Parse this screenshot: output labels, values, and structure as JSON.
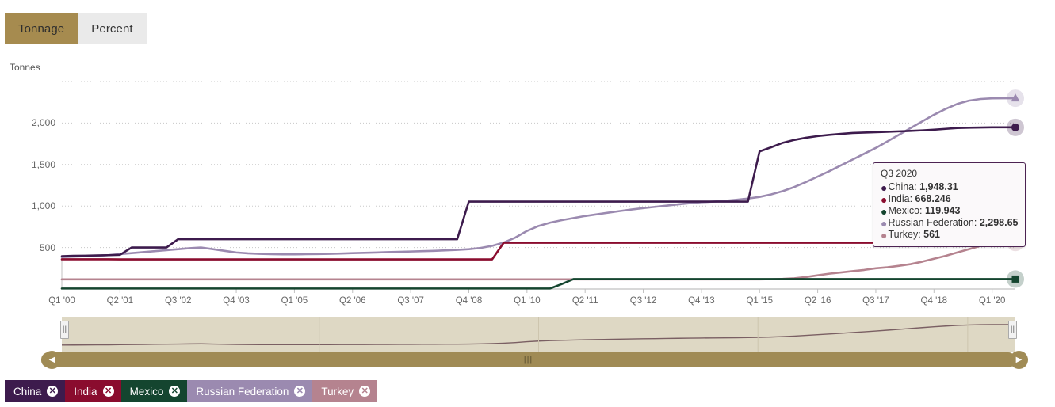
{
  "toggle": {
    "options": [
      {
        "label": "Tonnage",
        "active": true
      },
      {
        "label": "Percent",
        "active": false
      }
    ]
  },
  "axis_unit_label": "Tonnes",
  "tooltip": {
    "title": "Q3 2020",
    "rows": [
      {
        "name": "China",
        "value": "1,948.31",
        "color": "#3d1b4d"
      },
      {
        "name": "India",
        "value": "668.246",
        "color": "#8a0c2e"
      },
      {
        "name": "Mexico",
        "value": "119.943",
        "color": "#14452f"
      },
      {
        "name": "Russian Federation",
        "value": "2,298.65",
        "color": "#9b8ab0"
      },
      {
        "name": "Turkey",
        "value": "561",
        "color": "#b5838f"
      }
    ]
  },
  "navigator": {
    "left_arrow": "◀",
    "right_arrow": "▶",
    "grip": "|||",
    "left_handle": "||",
    "right_handle": "||"
  },
  "legend": {
    "items": [
      {
        "label": "China",
        "color": "#3d1b4d",
        "close": "✕"
      },
      {
        "label": "India",
        "color": "#8a0c2e",
        "close": "✕"
      },
      {
        "label": "Mexico",
        "color": "#14452f",
        "close": "✕"
      },
      {
        "label": "Russian Federation",
        "color": "#9b8ab0",
        "close": "✕"
      },
      {
        "label": "Turkey",
        "color": "#b5838f",
        "close": "✕"
      }
    ]
  },
  "chart_data": {
    "type": "line",
    "title": "",
    "xlabel": "",
    "ylabel": "Tonnes",
    "ylim": [
      0,
      2500
    ],
    "yticks": [
      500,
      1000,
      1500,
      2000
    ],
    "ytick_labels": [
      "500",
      "1,000",
      "1,500",
      "2,000"
    ],
    "grid": true,
    "legend_position": "bottom",
    "x_tick_labels": [
      "Q1 '00",
      "Q2 '01",
      "Q3 '02",
      "Q4 '03",
      "Q1 '05",
      "Q2 '06",
      "Q3 '07",
      "Q4 '08",
      "Q1 '10",
      "Q2 '11",
      "Q3 '12",
      "Q4 '13",
      "Q1 '15",
      "Q2 '16",
      "Q3 '17",
      "Q4 '18",
      "Q1 '20"
    ],
    "x_tick_indices": [
      0,
      5,
      10,
      15,
      20,
      25,
      30,
      35,
      40,
      45,
      50,
      55,
      60,
      65,
      70,
      75,
      80
    ],
    "x_index_range": [
      0,
      82
    ],
    "series": [
      {
        "name": "China",
        "color": "#3d1b4d",
        "marker": "circle",
        "values": [
          395,
          400,
          402,
          405,
          408,
          412,
          500,
          500,
          500,
          500,
          600,
          600,
          600,
          600,
          600,
          600,
          600,
          600,
          600,
          600,
          600,
          600,
          600,
          600,
          600,
          600,
          600,
          600,
          600,
          600,
          600,
          600,
          600,
          600,
          600,
          1054,
          1054,
          1054,
          1054,
          1054,
          1054,
          1054,
          1054,
          1054,
          1054,
          1054,
          1054,
          1054,
          1054,
          1054,
          1054,
          1054,
          1054,
          1054,
          1054,
          1054,
          1054,
          1054,
          1054,
          1054,
          1658,
          1708,
          1762,
          1797,
          1823,
          1843,
          1858,
          1870,
          1880,
          1885,
          1890,
          1895,
          1900,
          1905,
          1912,
          1920,
          1930,
          1940,
          1944,
          1946,
          1948,
          1948,
          1948
        ]
      },
      {
        "name": "India",
        "color": "#8a0c2e",
        "marker": "diamond",
        "values": [
          358,
          358,
          358,
          358,
          358,
          357,
          357,
          357,
          357,
          357,
          357,
          357,
          357,
          357,
          357,
          357,
          357,
          357,
          357,
          357,
          357,
          357,
          357,
          357,
          357,
          357,
          357,
          357,
          357,
          357,
          357,
          357,
          357,
          357,
          357,
          357,
          357,
          357,
          558,
          558,
          558,
          558,
          558,
          558,
          558,
          558,
          558,
          558,
          558,
          558,
          558,
          558,
          558,
          558,
          558,
          558,
          558,
          558,
          558,
          558,
          558,
          558,
          558,
          558,
          558,
          558,
          558,
          558,
          558,
          558,
          558,
          558,
          558,
          558,
          558,
          558,
          560,
          618,
          653,
          660,
          664,
          668,
          668
        ]
      },
      {
        "name": "Mexico",
        "color": "#14452f",
        "marker": "square",
        "values": [
          6,
          6,
          6,
          6,
          6,
          6,
          6,
          6,
          6,
          6,
          6,
          6,
          6,
          6,
          6,
          6,
          6,
          6,
          6,
          6,
          6,
          6,
          6,
          6,
          6,
          6,
          6,
          6,
          6,
          6,
          6,
          6,
          6,
          6,
          6,
          6,
          6,
          6,
          6,
          6,
          6,
          6,
          7,
          60,
          120,
          120,
          120,
          120,
          120,
          120,
          120,
          120,
          120,
          120,
          120,
          120,
          120,
          120,
          120,
          120,
          120,
          120,
          120,
          120,
          120,
          120,
          120,
          120,
          120,
          120,
          120,
          120,
          120,
          120,
          120,
          120,
          120,
          120,
          120,
          120,
          120,
          120,
          120
        ]
      },
      {
        "name": "Russian Federation",
        "color": "#9b8ab0",
        "marker": "triangle",
        "values": [
          384,
          390,
          395,
          400,
          408,
          420,
          432,
          444,
          456,
          468,
          480,
          492,
          500,
          480,
          460,
          440,
          430,
          424,
          420,
          418,
          418,
          420,
          422,
          424,
          428,
          432,
          436,
          440,
          444,
          448,
          452,
          456,
          460,
          466,
          472,
          480,
          495,
          520,
          560,
          620,
          700,
          760,
          800,
          830,
          855,
          880,
          900,
          920,
          940,
          958,
          975,
          990,
          1005,
          1020,
          1035,
          1046,
          1054,
          1062,
          1075,
          1090,
          1110,
          1140,
          1180,
          1230,
          1290,
          1355,
          1420,
          1490,
          1560,
          1630,
          1700,
          1780,
          1860,
          1940,
          2020,
          2100,
          2170,
          2230,
          2270,
          2290,
          2298,
          2299,
          2299
        ]
      },
      {
        "name": "Turkey",
        "color": "#b5838f",
        "marker": "inverted-triangle",
        "values": [
          116,
          116,
          116,
          116,
          116,
          116,
          116,
          116,
          116,
          116,
          116,
          116,
          116,
          116,
          116,
          116,
          116,
          116,
          116,
          116,
          116,
          116,
          116,
          116,
          116,
          116,
          116,
          116,
          116,
          116,
          116,
          116,
          116,
          116,
          116,
          116,
          116,
          116,
          116,
          116,
          116,
          116,
          116,
          116,
          116,
          116,
          116,
          116,
          116,
          116,
          116,
          116,
          116,
          116,
          116,
          116,
          116,
          116,
          116,
          116,
          116,
          118,
          122,
          130,
          145,
          165,
          185,
          200,
          215,
          230,
          250,
          262,
          280,
          300,
          330,
          365,
          400,
          440,
          480,
          520,
          550,
          561,
          561
        ]
      }
    ],
    "navigator_series": {
      "name": "Russian Federation",
      "color": "#7a5f63"
    }
  }
}
